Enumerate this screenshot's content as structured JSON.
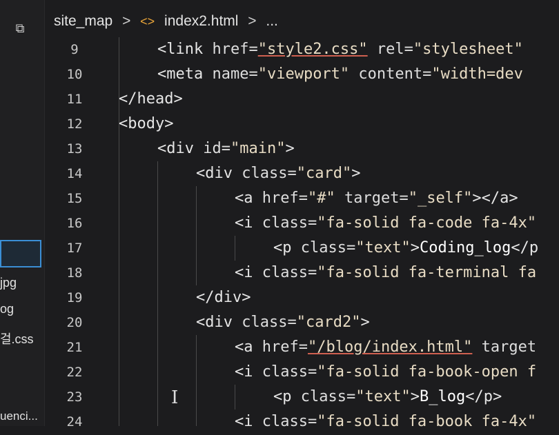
{
  "sidebar": {
    "icon": "copy-icon",
    "files": [
      {
        "label": "jpg"
      },
      {
        "label": "og"
      },
      {
        "label": "걸.css"
      },
      {
        "label": "uenci..."
      }
    ]
  },
  "breadcrumb": {
    "folder": "site_map",
    "sep1": ">",
    "file_icon": "<>",
    "file": "index2.html",
    "sep2": ">",
    "more": "..."
  },
  "lines": [
    {
      "num": "9",
      "parts": [
        [
          "tag",
          "<link "
        ],
        [
          "attr",
          "href="
        ],
        [
          "str ul",
          "\"style2.css\""
        ],
        [
          "attr",
          " rel="
        ],
        [
          "str",
          "\"stylesheet\""
        ]
      ]
    },
    {
      "num": "10",
      "parts": [
        [
          "tag",
          "<meta "
        ],
        [
          "attr",
          "name="
        ],
        [
          "str",
          "\"viewport\""
        ],
        [
          "attr",
          " content="
        ],
        [
          "str",
          "\"width=dev"
        ]
      ]
    },
    {
      "num": "11",
      "parts": [
        [
          "tag",
          "</head>"
        ]
      ]
    },
    {
      "num": "12",
      "parts": [
        [
          "tag",
          "<body>"
        ]
      ]
    },
    {
      "num": "13",
      "parts": [
        [
          "tag",
          "<div "
        ],
        [
          "attr",
          "id="
        ],
        [
          "str",
          "\"main\""
        ],
        [
          "tag",
          ">"
        ]
      ]
    },
    {
      "num": "14",
      "parts": [
        [
          "tag",
          "<div "
        ],
        [
          "attr",
          "class="
        ],
        [
          "str",
          "\"card\""
        ],
        [
          "tag",
          ">"
        ]
      ]
    },
    {
      "num": "15",
      "parts": [
        [
          "tag",
          "<a "
        ],
        [
          "attr",
          "href="
        ],
        [
          "str",
          "\"#\""
        ],
        [
          "attr",
          " target="
        ],
        [
          "str",
          "\"_self\""
        ],
        [
          "tag",
          "></a>"
        ]
      ]
    },
    {
      "num": "16",
      "parts": [
        [
          "tag",
          "<i "
        ],
        [
          "attr",
          "class="
        ],
        [
          "str",
          "\"fa-solid fa-code fa-4x\""
        ]
      ]
    },
    {
      "num": "17",
      "parts": [
        [
          "tag",
          "<p "
        ],
        [
          "attr",
          "class="
        ],
        [
          "str",
          "\"text\""
        ],
        [
          "tag",
          ">"
        ],
        [
          "txt",
          "Coding_log"
        ],
        [
          "tag",
          "</p"
        ]
      ]
    },
    {
      "num": "18",
      "parts": [
        [
          "tag",
          "<i "
        ],
        [
          "attr",
          "class="
        ],
        [
          "str",
          "\"fa-solid fa-terminal fa"
        ]
      ]
    },
    {
      "num": "19",
      "parts": [
        [
          "tag",
          "</div>"
        ]
      ]
    },
    {
      "num": "20",
      "parts": [
        [
          "tag",
          "<div "
        ],
        [
          "attr",
          "class="
        ],
        [
          "str",
          "\"card2\""
        ],
        [
          "tag",
          ">"
        ]
      ]
    },
    {
      "num": "21",
      "parts": [
        [
          "tag",
          "<a "
        ],
        [
          "attr",
          "href="
        ],
        [
          "str ul",
          "\"/blog/index.html\""
        ],
        [
          "attr",
          " target"
        ]
      ]
    },
    {
      "num": "22",
      "parts": [
        [
          "tag",
          "<i "
        ],
        [
          "attr",
          "class="
        ],
        [
          "str",
          "\"fa-solid fa-book-open f"
        ]
      ]
    },
    {
      "num": "23",
      "parts": [
        [
          "tag",
          "<p "
        ],
        [
          "attr",
          "class="
        ],
        [
          "str",
          "\"text\""
        ],
        [
          "tag",
          ">"
        ],
        [
          "txt",
          "B_log"
        ],
        [
          "tag",
          "</p>"
        ]
      ]
    },
    {
      "num": "24",
      "parts": [
        [
          "tag",
          "<i "
        ],
        [
          "attr",
          "class="
        ],
        [
          "str",
          "\"fa-solid fa-book fa-4x\""
        ]
      ]
    }
  ]
}
